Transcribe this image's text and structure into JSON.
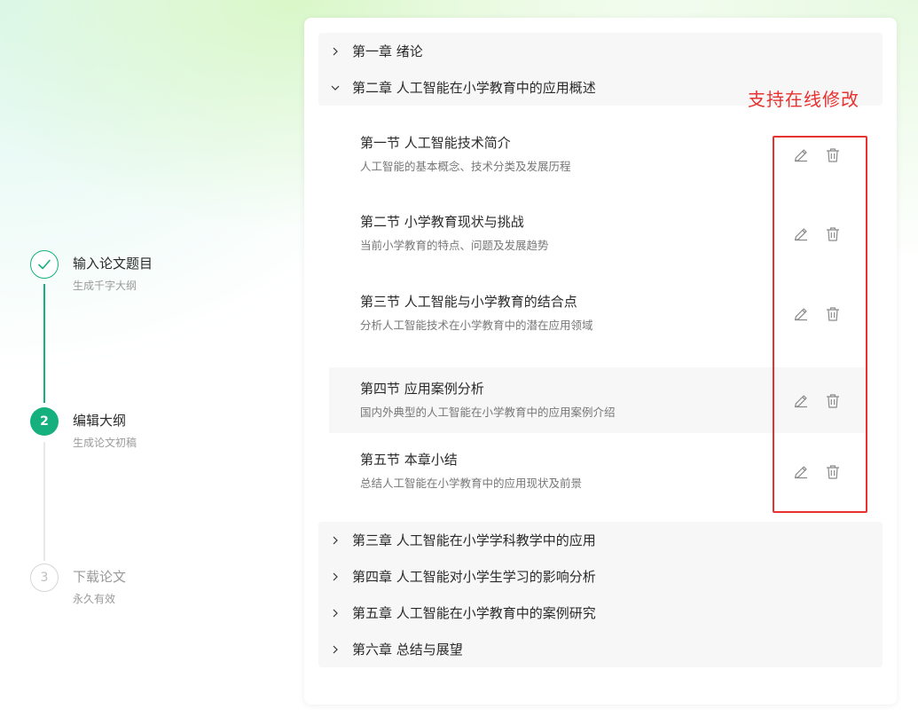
{
  "steps": [
    {
      "title": "输入论文题目",
      "subtitle": "生成千字大纲",
      "status": "done"
    },
    {
      "number": "2",
      "title": "编辑大纲",
      "subtitle": "生成论文初稿",
      "status": "active"
    },
    {
      "number": "3",
      "title": "下载论文",
      "subtitle": "永久有效",
      "status": "todo"
    }
  ],
  "outline": {
    "chapters_top": [
      {
        "title": "第一章 绪论",
        "expanded": false
      },
      {
        "title": "第二章 人工智能在小学教育中的应用概述",
        "expanded": true
      }
    ],
    "sections": [
      {
        "title": "第一节 人工智能技术简介",
        "desc": "人工智能的基本概念、技术分类及发展历程"
      },
      {
        "title": "第二节 小学教育现状与挑战",
        "desc": "当前小学教育的特点、问题及发展趋势"
      },
      {
        "title": "第三节 人工智能与小学教育的结合点",
        "desc": "分析人工智能技术在小学教育中的潜在应用领域"
      },
      {
        "title": "第四节 应用案例分析",
        "desc": "国内外典型的人工智能在小学教育中的应用案例介绍",
        "highlighted": true
      },
      {
        "title": "第五节 本章小结",
        "desc": "总结人工智能在小学教育中的应用现状及前景"
      }
    ],
    "chapters_bottom": [
      {
        "title": "第三章 人工智能在小学学科教学中的应用",
        "expanded": false
      },
      {
        "title": "第四章 人工智能对小学生学习的影响分析",
        "expanded": false
      },
      {
        "title": "第五章 人工智能在小学教育中的案例研究",
        "expanded": false
      },
      {
        "title": "第六章 总结与展望",
        "expanded": false
      }
    ]
  },
  "annotation": {
    "text": "支持在线修改",
    "color": "#e8322f"
  },
  "colors": {
    "accent": "#15b07e",
    "muted": "#bdbdbd"
  },
  "icons": {
    "section_edit": "pencil-icon",
    "section_delete": "trash-icon",
    "chapter_toggle": "chevron-icon",
    "step_done": "check-icon"
  }
}
